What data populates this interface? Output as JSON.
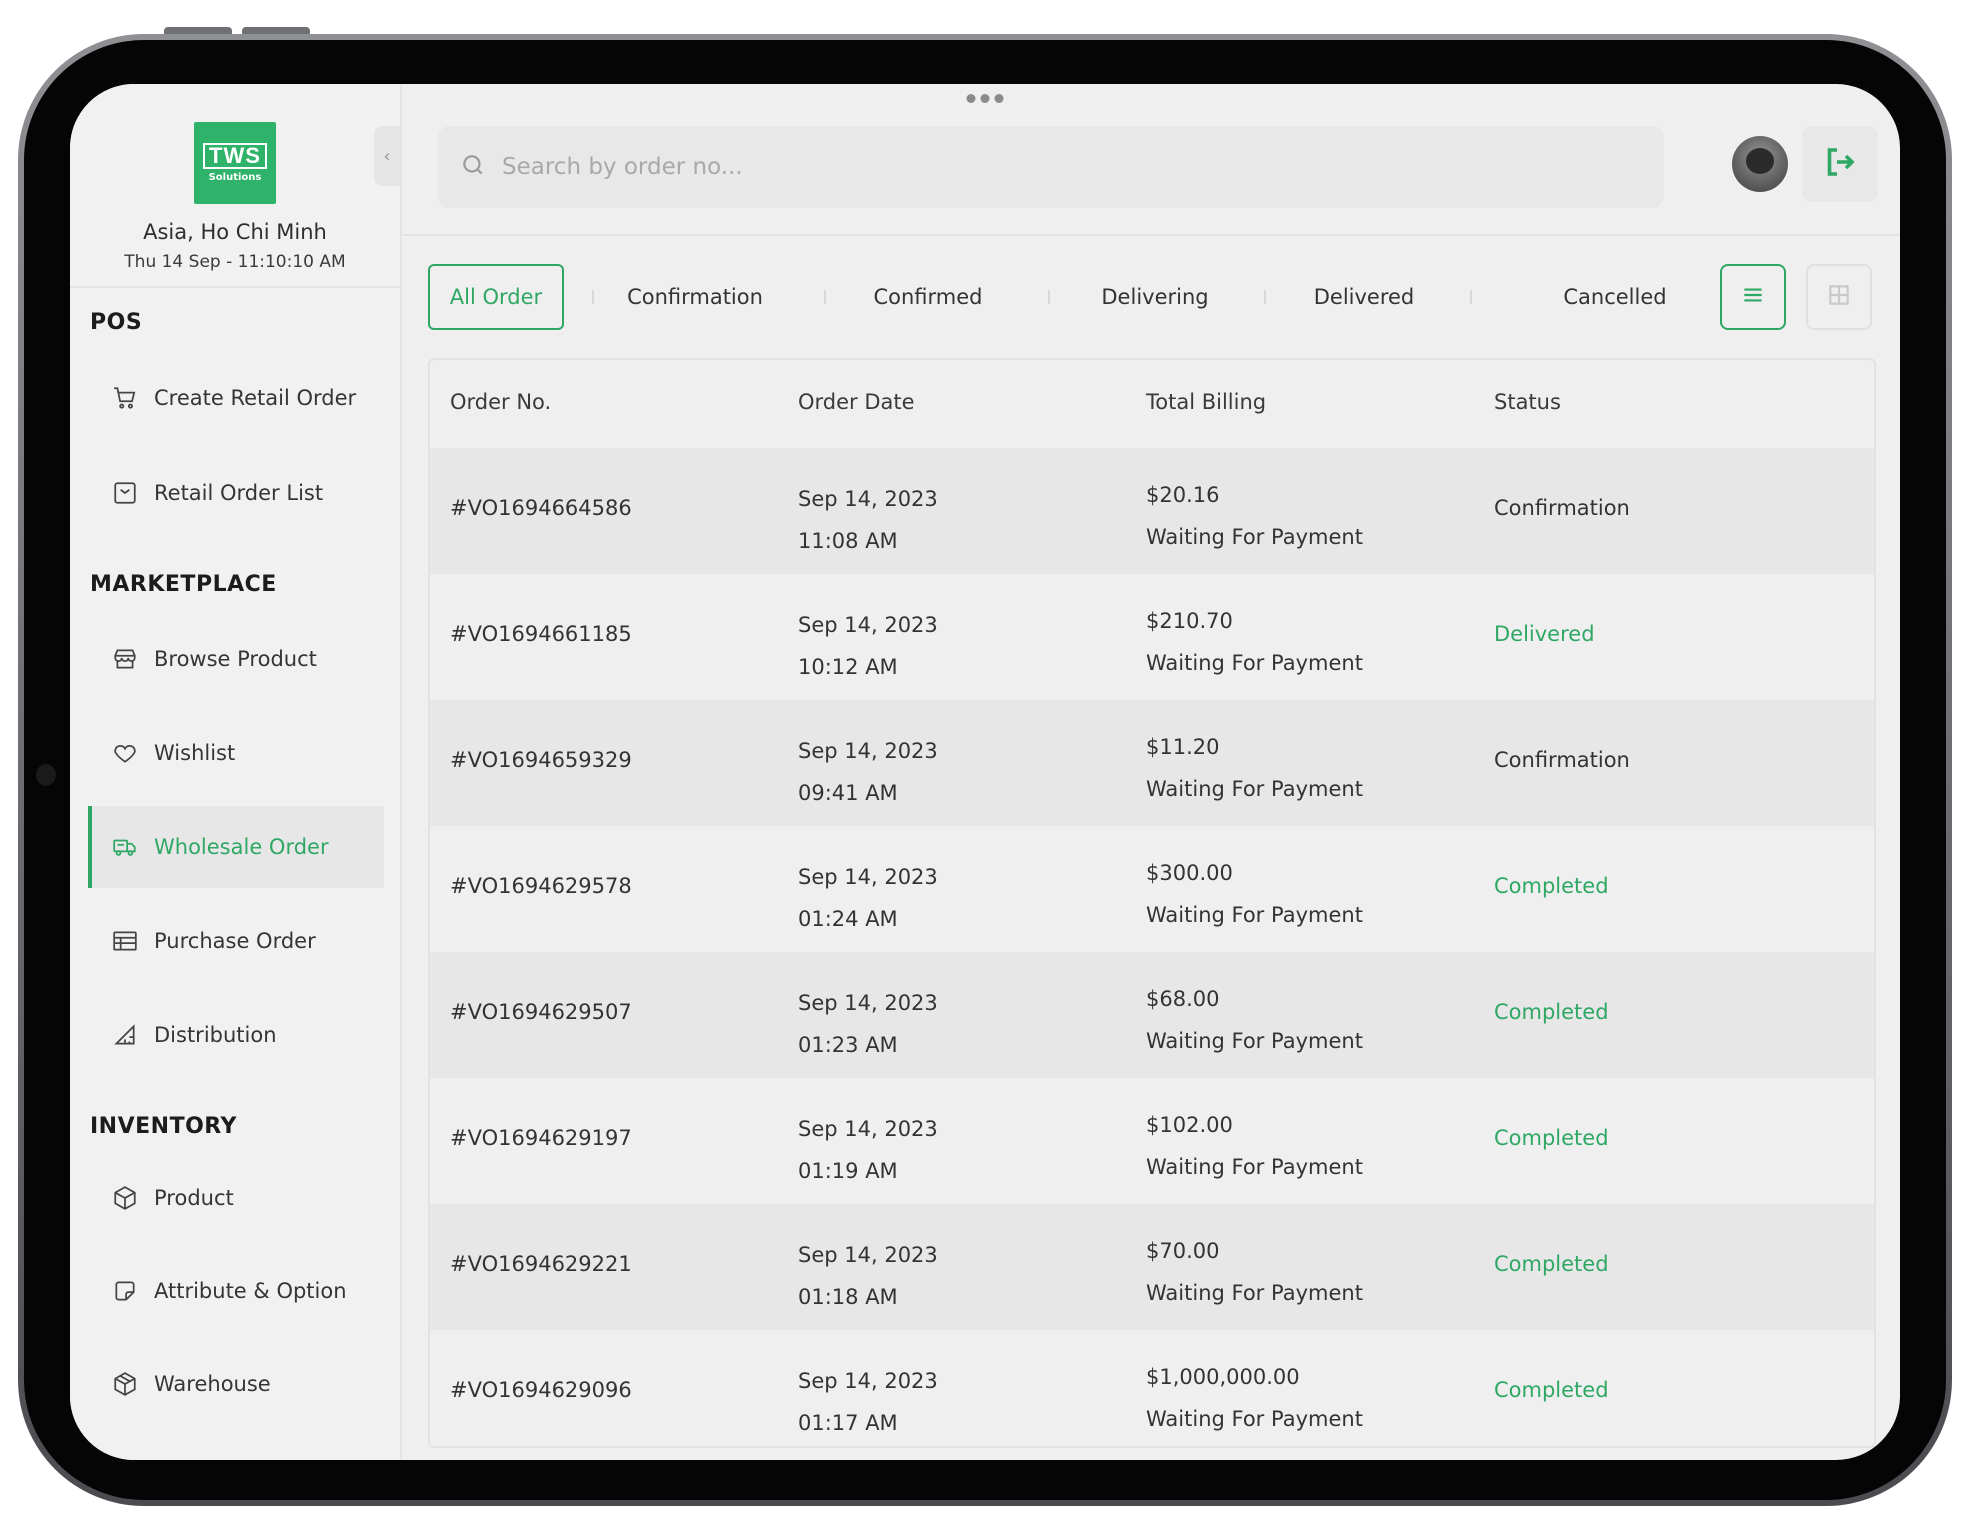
{
  "sidebar": {
    "logo_main": "TWS",
    "logo_sub": "Solutions",
    "location": "Asia, Ho Chi Minh",
    "datetime": "Thu 14 Sep - 11:10:10 AM",
    "sections": {
      "pos": "POS",
      "marketplace": "MARKETPLACE",
      "inventory": "INVENTORY"
    },
    "items": [
      {
        "label": "Create Retail Order",
        "icon": "cart-icon"
      },
      {
        "label": "Retail Order List",
        "icon": "inbox-icon"
      },
      {
        "label": "Browse Product",
        "icon": "store-icon"
      },
      {
        "label": "Wishlist",
        "icon": "heart-icon"
      },
      {
        "label": "Wholesale Order",
        "icon": "truck-icon",
        "active": true
      },
      {
        "label": "Purchase Order",
        "icon": "table-icon"
      },
      {
        "label": "Distribution",
        "icon": "triangle-ruler-icon"
      },
      {
        "label": "Product",
        "icon": "box-icon"
      },
      {
        "label": "Attribute & Option",
        "icon": "sticker-icon"
      },
      {
        "label": "Warehouse",
        "icon": "package-icon"
      }
    ]
  },
  "header": {
    "search_placeholder": "Search by order no..."
  },
  "tabs": [
    "All Order",
    "Confirmation",
    "Confirmed",
    "Delivering",
    "Delivered",
    "Cancelled"
  ],
  "table": {
    "headers": [
      "Order No.",
      "Order Date",
      "Total Billing",
      "Status"
    ],
    "rows": [
      {
        "no": "#VO1694664586",
        "date": "Sep 14, 2023",
        "time": "11:08 AM",
        "amount": "$20.16",
        "payment": "Waiting For Payment",
        "status": "Confirmation"
      },
      {
        "no": "#VO1694661185",
        "date": "Sep 14, 2023",
        "time": "10:12 AM",
        "amount": "$210.70",
        "payment": "Waiting For Payment",
        "status": "Delivered"
      },
      {
        "no": "#VO1694659329",
        "date": "Sep 14, 2023",
        "time": "09:41 AM",
        "amount": "$11.20",
        "payment": "Waiting For Payment",
        "status": "Confirmation"
      },
      {
        "no": "#VO1694629578",
        "date": "Sep 14, 2023",
        "time": "01:24 AM",
        "amount": "$300.00",
        "payment": "Waiting For Payment",
        "status": "Completed"
      },
      {
        "no": "#VO1694629507",
        "date": "Sep 14, 2023",
        "time": "01:23 AM",
        "amount": "$68.00",
        "payment": "Waiting For Payment",
        "status": "Completed"
      },
      {
        "no": "#VO1694629197",
        "date": "Sep 14, 2023",
        "time": "01:19 AM",
        "amount": "$102.00",
        "payment": "Waiting For Payment",
        "status": "Completed"
      },
      {
        "no": "#VO1694629221",
        "date": "Sep 14, 2023",
        "time": "01:18 AM",
        "amount": "$70.00",
        "payment": "Waiting For Payment",
        "status": "Completed"
      },
      {
        "no": "#VO1694629096",
        "date": "Sep 14, 2023",
        "time": "01:17 AM",
        "amount": "$1,000,000.00",
        "payment": "Waiting For Payment",
        "status": "Completed"
      }
    ]
  },
  "colors": {
    "accent": "#2fa865",
    "brand": "#2fb36a"
  }
}
